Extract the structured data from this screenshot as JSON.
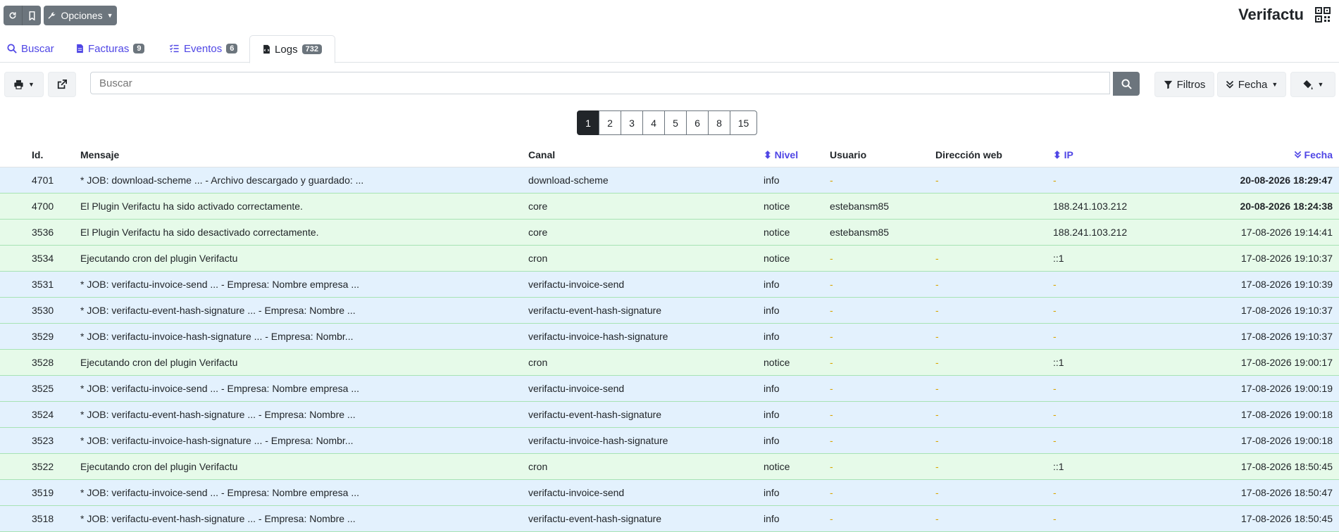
{
  "app": {
    "title": "Verifactu"
  },
  "topbar": {
    "options_label": "Opciones"
  },
  "tabs": [
    {
      "label": "Buscar"
    },
    {
      "label": "Facturas",
      "badge": "9"
    },
    {
      "label": "Eventos",
      "badge": "6"
    },
    {
      "label": "Logs",
      "badge": "732"
    }
  ],
  "toolbar": {
    "search_placeholder": "Buscar",
    "filters_label": "Filtros",
    "date_label": "Fecha"
  },
  "pagination": [
    "1",
    "2",
    "3",
    "4",
    "5",
    "6",
    "8",
    "15"
  ],
  "columns": {
    "id": "Id.",
    "message": "Mensaje",
    "channel": "Canal",
    "level": "Nivel",
    "user": "Usuario",
    "web": "Dirección web",
    "ip": "IP",
    "date": "Fecha"
  },
  "rows": [
    {
      "id": "4701",
      "message": "* JOB: download-scheme ... - Archivo descargado y guardado: ...",
      "channel": "download-scheme",
      "level": "info",
      "user": "-",
      "web": "-",
      "ip": "-",
      "date": "20-08-2026 18:29:47"
    },
    {
      "id": "4700",
      "message": "El Plugin Verifactu ha sido activado correctamente.",
      "channel": "core",
      "level": "notice",
      "user": "estebansm85",
      "web": "",
      "ip": "188.241.103.212",
      "date": "20-08-2026 18:24:38"
    },
    {
      "id": "3536",
      "message": "El Plugin Verifactu ha sido desactivado correctamente.",
      "channel": "core",
      "level": "notice",
      "user": "estebansm85",
      "web": "",
      "ip": "188.241.103.212",
      "date": "17-08-2026 19:14:41"
    },
    {
      "id": "3534",
      "message": "Ejecutando cron del plugin Verifactu",
      "channel": "cron",
      "level": "notice",
      "user": "-",
      "web": "-",
      "ip": "::1",
      "date": "17-08-2026 19:10:37"
    },
    {
      "id": "3531",
      "message": "* JOB: verifactu-invoice-send ... - Empresa: Nombre empresa ...",
      "channel": "verifactu-invoice-send",
      "level": "info",
      "user": "-",
      "web": "-",
      "ip": "-",
      "date": "17-08-2026 19:10:39"
    },
    {
      "id": "3530",
      "message": "* JOB: verifactu-event-hash-signature ... - Empresa: Nombre ...",
      "channel": "verifactu-event-hash-signature",
      "level": "info",
      "user": "-",
      "web": "-",
      "ip": "-",
      "date": "17-08-2026 19:10:37"
    },
    {
      "id": "3529",
      "message": "* JOB: verifactu-invoice-hash-signature ... - Empresa: Nombr...",
      "channel": "verifactu-invoice-hash-signature",
      "level": "info",
      "user": "-",
      "web": "-",
      "ip": "-",
      "date": "17-08-2026 19:10:37"
    },
    {
      "id": "3528",
      "message": "Ejecutando cron del plugin Verifactu",
      "channel": "cron",
      "level": "notice",
      "user": "-",
      "web": "-",
      "ip": "::1",
      "date": "17-08-2026 19:00:17"
    },
    {
      "id": "3525",
      "message": "* JOB: verifactu-invoice-send ... - Empresa: Nombre empresa ...",
      "channel": "verifactu-invoice-send",
      "level": "info",
      "user": "-",
      "web": "-",
      "ip": "-",
      "date": "17-08-2026 19:00:19"
    },
    {
      "id": "3524",
      "message": "* JOB: verifactu-event-hash-signature ... - Empresa: Nombre ...",
      "channel": "verifactu-event-hash-signature",
      "level": "info",
      "user": "-",
      "web": "-",
      "ip": "-",
      "date": "17-08-2026 19:00:18"
    },
    {
      "id": "3523",
      "message": "* JOB: verifactu-invoice-hash-signature ... - Empresa: Nombr...",
      "channel": "verifactu-invoice-hash-signature",
      "level": "info",
      "user": "-",
      "web": "-",
      "ip": "-",
      "date": "17-08-2026 19:00:18"
    },
    {
      "id": "3522",
      "message": "Ejecutando cron del plugin Verifactu",
      "channel": "cron",
      "level": "notice",
      "user": "-",
      "web": "-",
      "ip": "::1",
      "date": "17-08-2026 18:50:45"
    },
    {
      "id": "3519",
      "message": "* JOB: verifactu-invoice-send ... - Empresa: Nombre empresa ...",
      "channel": "verifactu-invoice-send",
      "level": "info",
      "user": "-",
      "web": "-",
      "ip": "-",
      "date": "17-08-2026 18:50:47"
    },
    {
      "id": "3518",
      "message": "* JOB: verifactu-event-hash-signature ... - Empresa: Nombre ...",
      "channel": "verifactu-event-hash-signature",
      "level": "info",
      "user": "-",
      "web": "-",
      "ip": "-",
      "date": "17-08-2026 18:50:45"
    }
  ]
}
